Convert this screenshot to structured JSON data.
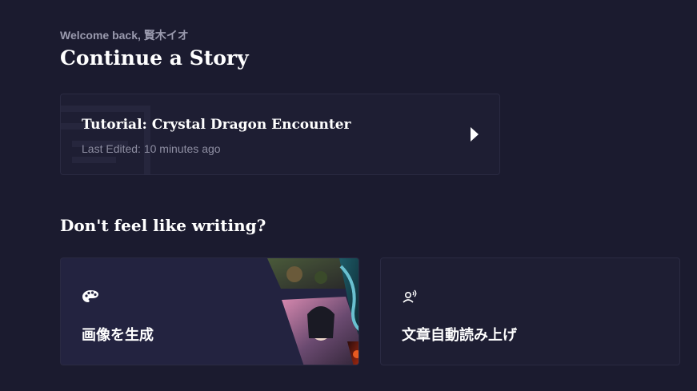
{
  "header": {
    "welcome": "Welcome back, 賢木イオ",
    "title": "Continue a Story"
  },
  "recent_story": {
    "title": "Tutorial: Crystal Dragon Encounter",
    "last_edited": "Last Edited: 10 minutes ago",
    "action_icon": "play-icon"
  },
  "alternatives": {
    "heading": "Don't feel like writing?",
    "cards": [
      {
        "label": "画像を生成",
        "icon": "palette-icon"
      },
      {
        "label": "文章自動読み上げ",
        "icon": "voice-icon"
      }
    ]
  },
  "colors": {
    "background": "#1b1b2f",
    "card": "#1e1e33",
    "border": "#2a2a42",
    "muted_text": "#8e8ea2"
  }
}
